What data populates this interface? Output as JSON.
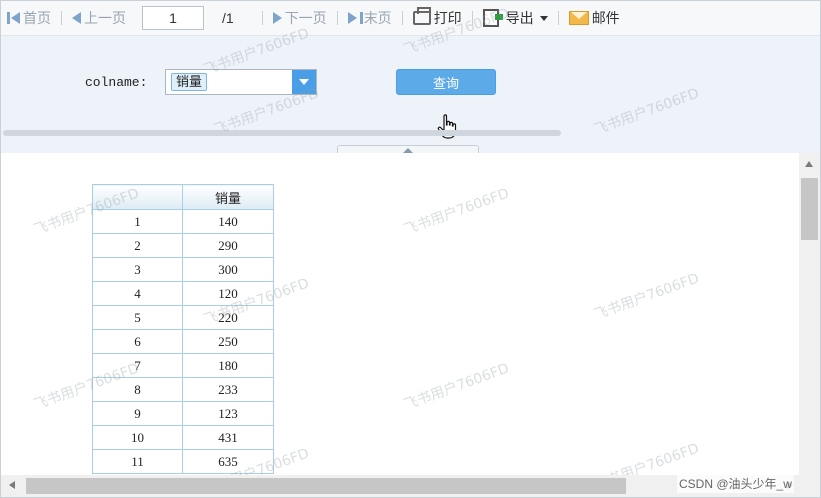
{
  "toolbar": {
    "first_label": "首页",
    "prev_label": "上一页",
    "page_value": "1",
    "page_total": "/1",
    "next_label": "下一页",
    "last_label": "末页",
    "print_label": "打印",
    "export_label": "导出",
    "mail_label": "邮件"
  },
  "params": {
    "colname_label": "colname:",
    "selected_tag": "销量",
    "query_label": "查询"
  },
  "table": {
    "header_index": "",
    "header_value": "销量",
    "rows": [
      {
        "idx": "1",
        "val": "140"
      },
      {
        "idx": "2",
        "val": "290"
      },
      {
        "idx": "3",
        "val": "300"
      },
      {
        "idx": "4",
        "val": "120"
      },
      {
        "idx": "5",
        "val": "220"
      },
      {
        "idx": "6",
        "val": "250"
      },
      {
        "idx": "7",
        "val": "180"
      },
      {
        "idx": "8",
        "val": "233"
      },
      {
        "idx": "9",
        "val": "123"
      },
      {
        "idx": "10",
        "val": "431"
      },
      {
        "idx": "11",
        "val": "635"
      }
    ]
  },
  "watermark": "飞书用户7606FD",
  "credit": "CSDN @油头少年_w",
  "colors": {
    "accent": "#4a9ee6",
    "panel_bg": "#eef3f9",
    "table_border": "#a9cfe7"
  }
}
